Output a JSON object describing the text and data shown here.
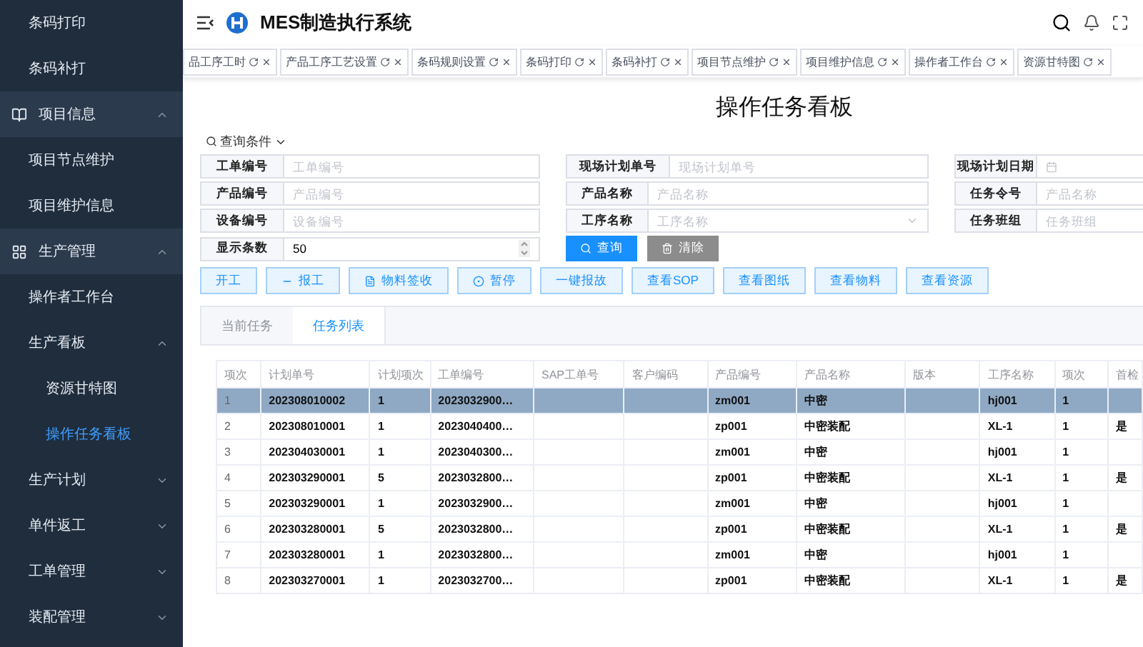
{
  "sidebar": {
    "items": [
      {
        "label": "条码打印",
        "kind": "link",
        "selected": false
      },
      {
        "label": "条码补打",
        "kind": "link",
        "selected": false
      },
      {
        "label": "项目信息",
        "kind": "group",
        "expanded": true,
        "children": [
          {
            "label": "项目节点维护",
            "selected": false
          },
          {
            "label": "项目维护信息",
            "selected": false
          }
        ]
      },
      {
        "label": "生产管理",
        "kind": "group",
        "expanded": true,
        "children": [
          {
            "label": "操作者工作台",
            "selected": false
          },
          {
            "label": "生产看板",
            "expanded": true,
            "children": [
              {
                "label": "资源甘特图",
                "selected": false
              },
              {
                "label": "操作任务看板",
                "selected": true
              }
            ]
          },
          {
            "label": "生产计划",
            "expanded": false
          },
          {
            "label": "单件返工",
            "expanded": false
          },
          {
            "label": "工单管理",
            "expanded": false
          },
          {
            "label": "装配管理",
            "expanded": false
          }
        ]
      }
    ]
  },
  "header": {
    "title": "MES制造执行系统"
  },
  "tags": [
    "品工序工时",
    "产品工序工艺设置",
    "条码规则设置",
    "条码打印",
    "条码补打",
    "项目节点维护",
    "项目维护信息",
    "操作者工作台",
    "资源甘特图"
  ],
  "page_title": "操作任务看板",
  "query_toggle": "查询条件",
  "filters": [
    [
      {
        "label": "工单编号",
        "kind": "text",
        "placeholder": "工单编号"
      },
      {
        "label": "现场计划单号",
        "kind": "text",
        "placeholder": "现场计划单号"
      },
      {
        "label": "现场计划日期",
        "kind": "date"
      }
    ],
    [
      {
        "label": "产品编号",
        "kind": "text",
        "placeholder": "产品编号"
      },
      {
        "label": "产品名称",
        "kind": "text",
        "placeholder": "产品名称"
      },
      {
        "label": "任务令号",
        "kind": "text",
        "placeholder": "产品名称"
      }
    ],
    [
      {
        "label": "设备编号",
        "kind": "text",
        "placeholder": "设备编号"
      },
      {
        "label": "工序名称",
        "kind": "select",
        "placeholder": "工序名称"
      },
      {
        "label": "任务班组",
        "kind": "text",
        "placeholder": "任务班组"
      }
    ],
    [
      {
        "label": "显示条数",
        "kind": "number",
        "value": "50"
      }
    ]
  ],
  "query_buttons": [
    {
      "label": "查询",
      "kind": "primary"
    },
    {
      "label": "清除",
      "kind": "secondary"
    }
  ],
  "actions": [
    "开工",
    "报工",
    "物料签收",
    "暂停",
    "一键报故",
    "查看SOP",
    "查看图纸",
    "查看物料",
    "查看资源"
  ],
  "tabs": [
    {
      "label": "当前任务",
      "selected": false
    },
    {
      "label": "任务列表",
      "selected": true
    }
  ],
  "table": {
    "columns": [
      "项次",
      "计划单号",
      "计划项次",
      "工单编号",
      "SAP工单号",
      "客户编码",
      "产品编号",
      "产品名称",
      "版本",
      "工序名称",
      "项次",
      "首检"
    ],
    "rows": [
      {
        "selected": true,
        "cells": [
          "1",
          "202308010002",
          "1",
          "2023032900…",
          "",
          "",
          "zm001",
          "中密",
          "",
          "hj001",
          "1",
          ""
        ]
      },
      {
        "selected": false,
        "cells": [
          "2",
          "202308010001",
          "1",
          "2023040400…",
          "",
          "",
          "zp001",
          "中密装配",
          "",
          "XL-1",
          "1",
          "是"
        ]
      },
      {
        "selected": false,
        "cells": [
          "3",
          "202304030001",
          "1",
          "2023040300…",
          "",
          "",
          "zm001",
          "中密",
          "",
          "hj001",
          "1",
          ""
        ]
      },
      {
        "selected": false,
        "cells": [
          "4",
          "202303290001",
          "5",
          "2023032800…",
          "",
          "",
          "zp001",
          "中密装配",
          "",
          "XL-1",
          "1",
          "是"
        ]
      },
      {
        "selected": false,
        "cells": [
          "5",
          "202303290001",
          "1",
          "2023032900…",
          "",
          "",
          "zm001",
          "中密",
          "",
          "hj001",
          "1",
          ""
        ]
      },
      {
        "selected": false,
        "cells": [
          "6",
          "202303280001",
          "5",
          "2023032800…",
          "",
          "",
          "zp001",
          "中密装配",
          "",
          "XL-1",
          "1",
          "是"
        ]
      },
      {
        "selected": false,
        "cells": [
          "7",
          "202303280001",
          "1",
          "2023032800…",
          "",
          "",
          "zm001",
          "中密",
          "",
          "hj001",
          "1",
          ""
        ]
      },
      {
        "selected": false,
        "cells": [
          "8",
          "202303270001",
          "1",
          "2023032700…",
          "",
          "",
          "zp001",
          "中密装配",
          "",
          "XL-1",
          "1",
          "是"
        ]
      }
    ]
  }
}
